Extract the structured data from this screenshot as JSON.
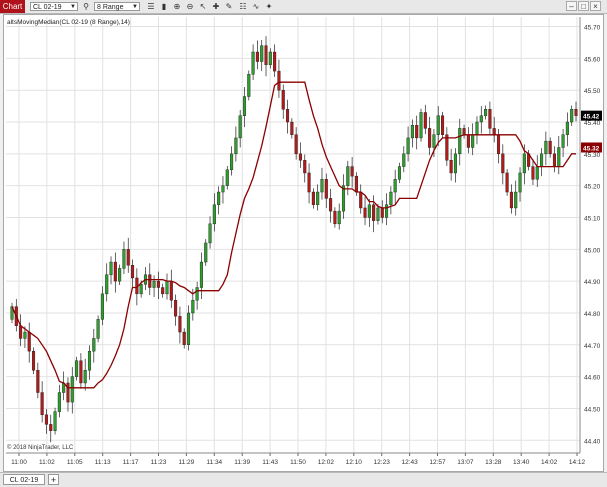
{
  "toolbar": {
    "chart_tab": "Chart",
    "instrument": "CL 02-19",
    "bar_type": "8 Range",
    "icons": [
      "search-icon",
      "bars-icon",
      "candles-icon",
      "zoom-in-icon",
      "zoom-out-icon",
      "pointer-icon",
      "crosshair-icon",
      "drawing-icon",
      "properties-icon",
      "strategy-icon",
      "indicator-icon"
    ],
    "window_buttons": [
      "minimize",
      "maximize",
      "close"
    ]
  },
  "chart_data": {
    "type": "candlestick",
    "title": "",
    "indicator_label": "altsMovingMedian(CL 02-19 (8 Range),14)",
    "copyright": "© 2018 NinjaTrader, LLC",
    "x_tick_labels": [
      "11:00",
      "11:02",
      "11:05",
      "11:13",
      "11:17",
      "11:23",
      "11:29",
      "11:34",
      "11:39",
      "11:43",
      "11:50",
      "12:02",
      "12:10",
      "12:23",
      "12:43",
      "12:57",
      "13:07",
      "13:28",
      "13:40",
      "14:02",
      "14:12"
    ],
    "y_ticks": [
      44.4,
      44.5,
      44.6,
      44.7,
      44.8,
      44.9,
      45.0,
      45.1,
      45.2,
      45.3,
      45.4,
      45.5,
      45.6,
      45.7
    ],
    "ylim": [
      44.36,
      45.73
    ],
    "last_price": 45.42,
    "indicator_last": 45.32,
    "grid": true,
    "colors": {
      "up": "#2f9e2f",
      "down": "#b01b1b",
      "indicator": "#8b0000",
      "price_marker": "#000000",
      "indicator_marker": "#8b0000"
    },
    "closes": [
      44.82,
      44.76,
      44.72,
      44.74,
      44.68,
      44.62,
      44.55,
      44.48,
      44.45,
      44.43,
      44.49,
      44.55,
      44.58,
      44.52,
      44.6,
      44.65,
      44.58,
      44.62,
      44.68,
      44.72,
      44.78,
      44.86,
      44.92,
      44.96,
      44.9,
      44.94,
      45,
      44.95,
      44.91,
      44.86,
      44.89,
      44.92,
      44.88,
      44.9,
      44.88,
      44.86,
      44.9,
      44.84,
      44.79,
      44.74,
      44.7,
      44.8,
      44.84,
      44.88,
      44.96,
      45.02,
      45.08,
      45.14,
      45.18,
      45.2,
      45.25,
      45.3,
      45.35,
      45.42,
      45.48,
      45.55,
      45.62,
      45.59,
      45.64,
      45.58,
      45.62,
      45.56,
      45.5,
      45.44,
      45.4,
      45.36,
      45.3,
      45.28,
      45.24,
      45.18,
      45.14,
      45.18,
      45.22,
      45.16,
      45.12,
      45.08,
      45.12,
      45.2,
      45.26,
      45.23,
      45.18,
      45.13,
      45.1,
      45.14,
      45.09,
      45.13,
      45.1,
      45.14,
      45.18,
      45.22,
      45.26,
      45.3,
      45.35,
      45.39,
      45.35,
      45.43,
      45.38,
      45.32,
      45.36,
      45.42,
      45.36,
      45.28,
      45.24,
      45.3,
      45.38,
      45.36,
      45.32,
      45.36,
      45.4,
      45.42,
      45.44,
      45.38,
      45.36,
      45.3,
      45.24,
      45.18,
      45.13,
      45.18,
      45.24,
      45.3,
      45.26,
      45.22,
      45.26,
      45.3,
      45.34,
      45.3,
      45.26,
      45.32,
      45.36,
      45.4,
      45.44,
      45.42
    ]
  },
  "bottom": {
    "tab_label": "CL 02-19",
    "add_tab": "+"
  }
}
